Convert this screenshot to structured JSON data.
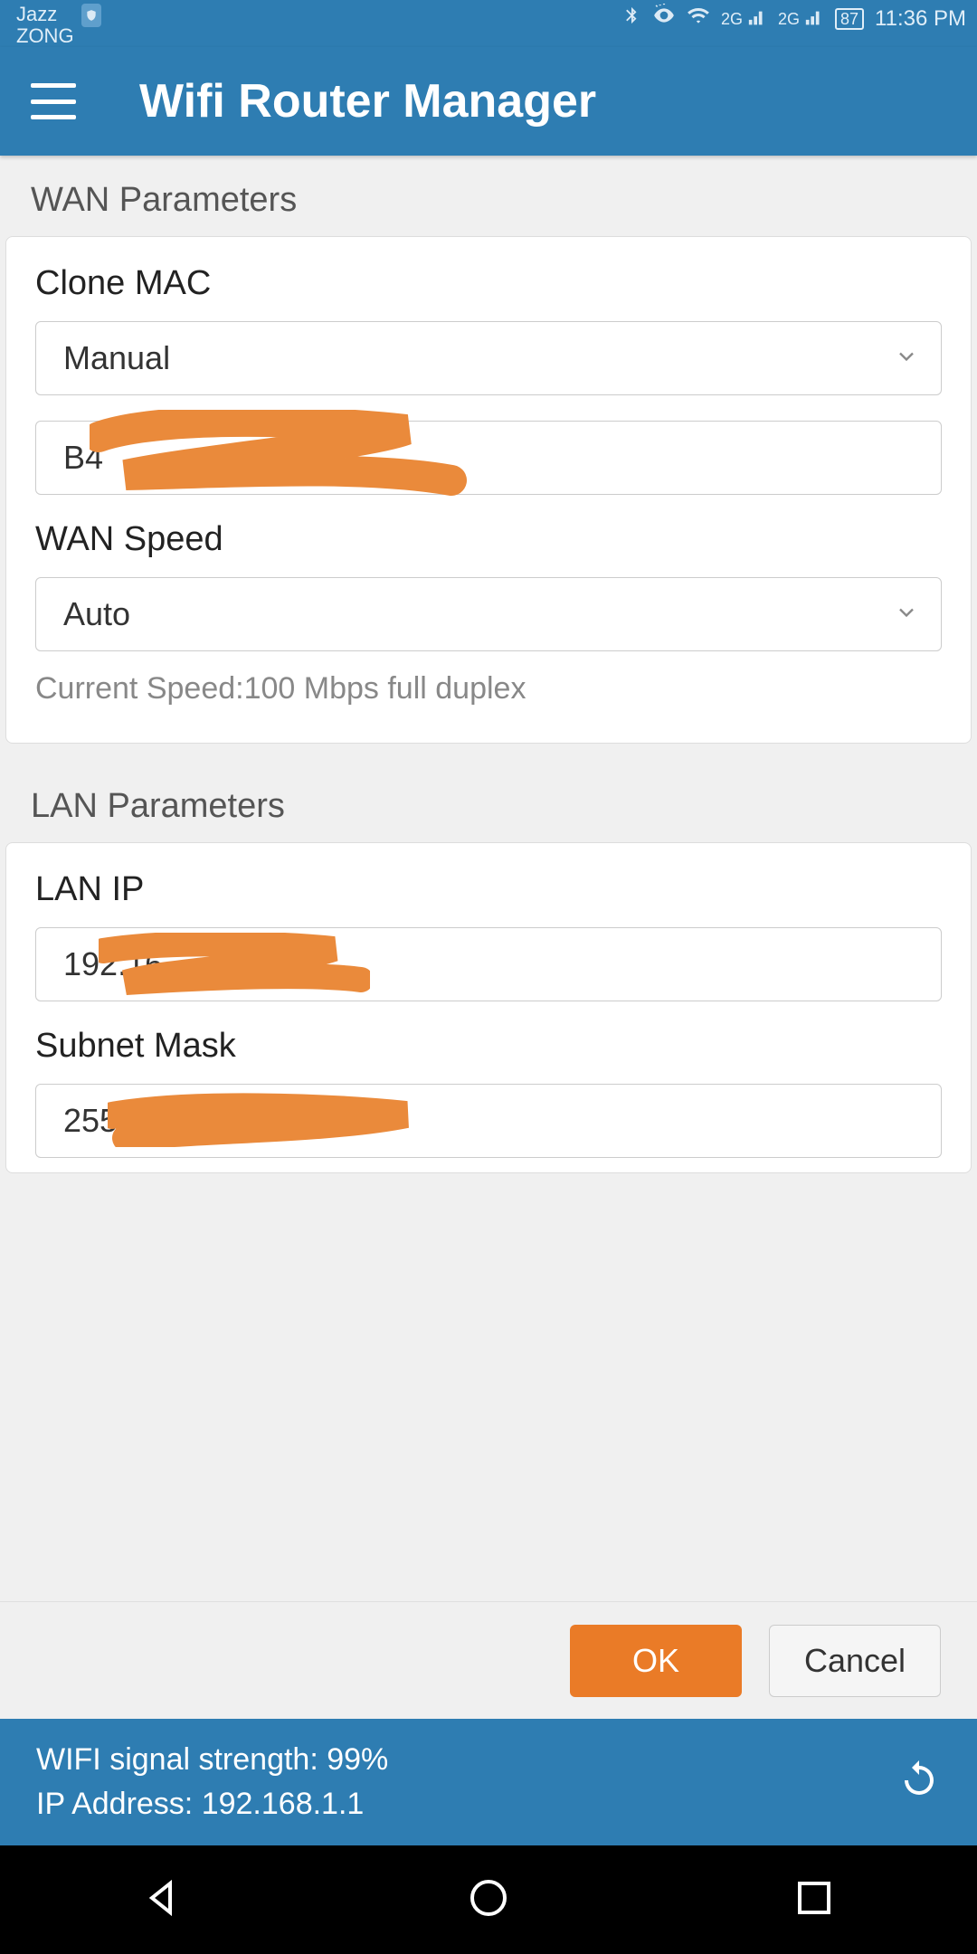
{
  "status": {
    "carrier1": "Jazz",
    "carrier2": "ZONG",
    "net_badge": "2G",
    "battery": "87",
    "time": "11:36 PM"
  },
  "header": {
    "title": "Wifi Router Manager"
  },
  "wan": {
    "section_title": "WAN Parameters",
    "clone_mac_label": "Clone MAC",
    "clone_mac_mode": "Manual",
    "clone_mac_value": "B4",
    "wan_speed_label": "WAN Speed",
    "wan_speed_value": "Auto",
    "current_speed": "Current Speed:100 Mbps full duplex"
  },
  "lan": {
    "section_title": "LAN Parameters",
    "lan_ip_label": "LAN IP",
    "lan_ip_value": "192.16",
    "subnet_label": "Subnet Mask",
    "subnet_value": "255"
  },
  "actions": {
    "ok": "OK",
    "cancel": "Cancel"
  },
  "footer": {
    "signal": "WIFI signal strength: 99%",
    "ip": "IP Address: 192.168.1.1"
  }
}
